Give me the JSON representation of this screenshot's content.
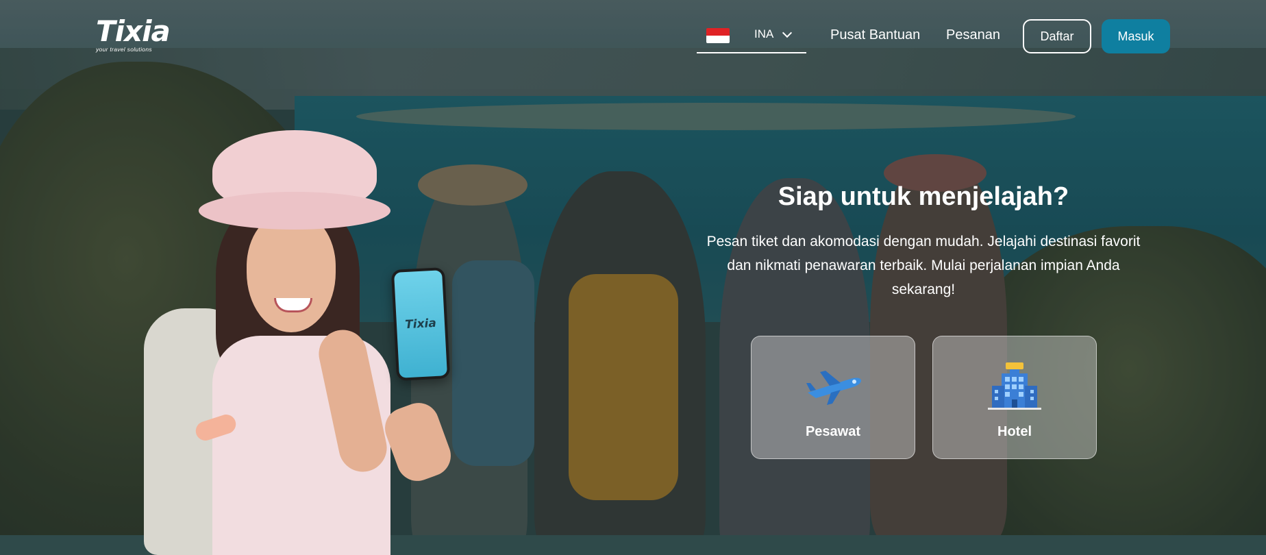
{
  "brand": {
    "name": "Tixia",
    "tagline": "your travel solutions"
  },
  "nav": {
    "language": {
      "code": "INA",
      "flag": "indonesia-flag-icon"
    },
    "links": [
      "Pusat Bantuan",
      "Pesanan"
    ],
    "register_label": "Daftar",
    "login_label": "Masuk"
  },
  "hero": {
    "title": "Siap untuk menjelajah?",
    "description": "Pesan tiket dan akomodasi dengan mudah. Jelajahi destinasi favorit dan nikmati penawaran terbaik. Mulai perjalanan impian Anda sekarang!",
    "services": [
      {
        "label": "Pesawat",
        "icon": "airplane-icon"
      },
      {
        "label": "Hotel",
        "icon": "hotel-building-icon"
      }
    ],
    "phone_logo": "Tixia"
  },
  "colors": {
    "primary": "#0f7fa0",
    "text": "#ffffff"
  }
}
